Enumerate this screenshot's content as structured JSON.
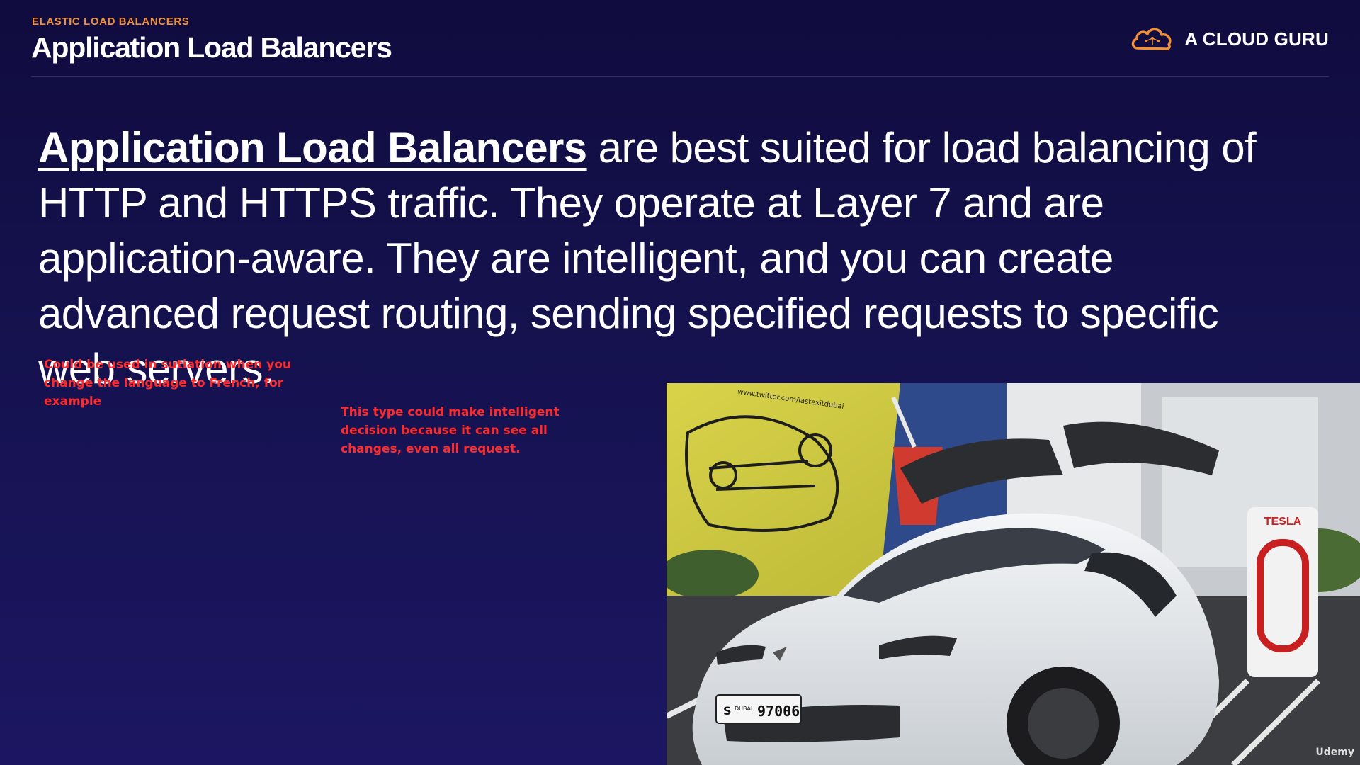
{
  "header": {
    "eyebrow": "ELASTIC LOAD BALANCERS",
    "title": "Application Load Balancers"
  },
  "brand": {
    "name": "A CLOUD GURU",
    "logo_icon": "cloud-icon",
    "logo_color": "#f0913a"
  },
  "body": {
    "highlight": "Application Load Balancers",
    "text": " are best suited for load balancing of HTTP and HTTPS traffic. They operate at Layer 7 and are application-aware. They are intelligent, and you can create advanced request routing, sending specified requests to specific web servers."
  },
  "annotations": {
    "note_1": "Could be used in sutiation when you change the language to French, for example",
    "note_2": "This type could make intelligent decision because it can see all changes, even all request.",
    "color": "#ff2a2a"
  },
  "photo": {
    "charger_label": "TESLA",
    "plate_number": "97006",
    "plate_region": "DUBAI",
    "plate_letter": "S",
    "sticker_url": "www.twitter.com/lastexitdubai",
    "watermark": "Udemy"
  },
  "colors": {
    "background_top": "#100c3f",
    "background_bottom": "#1c1662",
    "accent": "#f0913a"
  }
}
